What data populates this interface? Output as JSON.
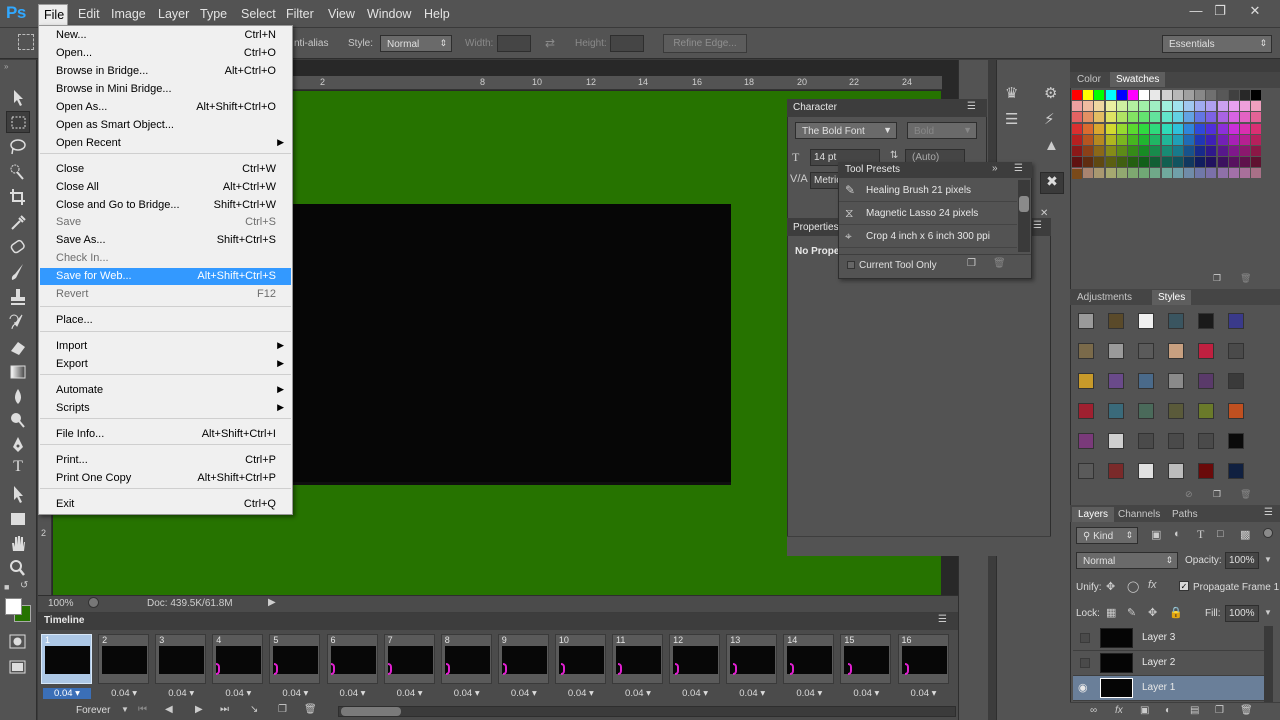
{
  "app": {
    "logo": "Ps"
  },
  "menubar": {
    "items": [
      "File",
      "Edit",
      "Image",
      "Layer",
      "Type",
      "Select",
      "Filter",
      "View",
      "Window",
      "Help"
    ],
    "window_controls": [
      "minimize-icon",
      "restore-icon",
      "close-icon"
    ]
  },
  "options": {
    "antialias": "nti-alias",
    "style_label": "Style:",
    "style_value": "Normal",
    "width_label": "Width:",
    "height_label": "Height:",
    "refine_edge": "Refine Edge...",
    "workspace": "Essentials"
  },
  "file_menu": [
    {
      "label": "New...",
      "shortcut": "Ctrl+N"
    },
    {
      "label": "Open...",
      "shortcut": "Ctrl+O"
    },
    {
      "label": "Browse in Bridge...",
      "shortcut": "Alt+Ctrl+O"
    },
    {
      "label": "Browse in Mini Bridge...",
      "shortcut": ""
    },
    {
      "label": "Open As...",
      "shortcut": "Alt+Shift+Ctrl+O"
    },
    {
      "label": "Open as Smart Object...",
      "shortcut": ""
    },
    {
      "label": "Open Recent",
      "shortcut": "",
      "submenu": true
    },
    {
      "label": "Close",
      "shortcut": "Ctrl+W"
    },
    {
      "label": "Close All",
      "shortcut": "Alt+Ctrl+W"
    },
    {
      "label": "Close and Go to Bridge...",
      "shortcut": "Shift+Ctrl+W"
    },
    {
      "label": "Save",
      "shortcut": "Ctrl+S",
      "disabled": true
    },
    {
      "label": "Save As...",
      "shortcut": "Shift+Ctrl+S"
    },
    {
      "label": "Check In...",
      "shortcut": "",
      "disabled": true
    },
    {
      "label": "Save for Web...",
      "shortcut": "Alt+Shift+Ctrl+S",
      "highlighted": true
    },
    {
      "label": "Revert",
      "shortcut": "F12",
      "disabled": true
    },
    {
      "label": "Place...",
      "shortcut": ""
    },
    {
      "label": "Import",
      "shortcut": "",
      "submenu": true
    },
    {
      "label": "Export",
      "shortcut": "",
      "submenu": true
    },
    {
      "label": "Automate",
      "shortcut": "",
      "submenu": true
    },
    {
      "label": "Scripts",
      "shortcut": "",
      "submenu": true
    },
    {
      "label": "File Info...",
      "shortcut": "Alt+Shift+Ctrl+I"
    },
    {
      "label": "Print...",
      "shortcut": "Ctrl+P"
    },
    {
      "label": "Print One Copy",
      "shortcut": "Alt+Shift+Ctrl+P"
    },
    {
      "label": "Exit",
      "shortcut": "Ctrl+Q"
    }
  ],
  "ruler": {
    "top_numbers": [
      "2",
      "4",
      "6",
      "8",
      "10",
      "12",
      "14",
      "16",
      "18",
      "20",
      "22",
      "24",
      "26"
    ],
    "left_numbers": [
      "2"
    ]
  },
  "status": {
    "zoom": "100%",
    "doc": "Doc: 439.5K/61.8M"
  },
  "timeline": {
    "title": "Timeline",
    "frames": [
      "1",
      "2",
      "3",
      "4",
      "5",
      "6",
      "7",
      "8",
      "9",
      "10",
      "11",
      "12",
      "13",
      "14",
      "15",
      "16"
    ],
    "delay": "0.04",
    "loop": "Forever"
  },
  "character": {
    "title": "Character",
    "font_family": "The Bold Font",
    "font_style": "Bold",
    "size": "14 pt",
    "leading": "(Auto)",
    "kerning": "Metric"
  },
  "tool_presets": {
    "title": "Tool Presets",
    "items": [
      "Healing Brush 21 pixels",
      "Magnetic Lasso 24 pixels",
      "Crop 4 inch x 6 inch 300 ppi"
    ],
    "current_only": "Current Tool Only"
  },
  "properties": {
    "title": "Properties",
    "empty": "No Prope"
  },
  "swatches_panel": {
    "tabs": [
      "Color",
      "Swatches"
    ]
  },
  "styles_panel": {
    "tabs": [
      "Adjustments",
      "Styles"
    ]
  },
  "layers_panel": {
    "tabs": [
      "Layers",
      "Channels",
      "Paths"
    ],
    "filter": "Kind",
    "blend": "Normal",
    "opacity_label": "Opacity:",
    "opacity": "100%",
    "unify_label": "Unify:",
    "propagate": "Propagate Frame 1",
    "lock_label": "Lock:",
    "fill_label": "Fill:",
    "fill": "100%",
    "layers": [
      "Layer 3",
      "Layer 2",
      "Layer 1"
    ]
  }
}
